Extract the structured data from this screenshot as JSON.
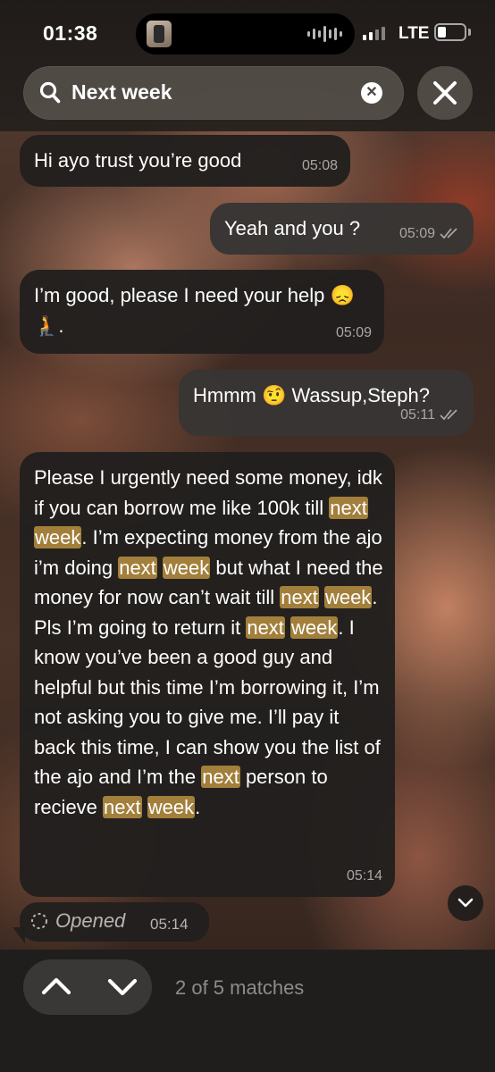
{
  "status_bar": {
    "time": "01:38",
    "network": "LTE"
  },
  "search": {
    "query": "Next week",
    "icon": "search-icon",
    "clear_icon": "clear-icon",
    "close_icon": "close-icon"
  },
  "messages": [
    {
      "direction": "incoming",
      "text": "Hi ayo trust you’re good",
      "time": "05:08",
      "read_receipt": false
    },
    {
      "direction": "outgoing",
      "text": "Yeah and you ?",
      "time": "05:09",
      "read_receipt": true
    },
    {
      "direction": "incoming",
      "text": "I’m good, please I need your help 😞 🧎.",
      "time": "05:09",
      "read_receipt": false
    },
    {
      "direction": "outgoing",
      "text": "Hmmm 🤨 Wassup,Steph?",
      "time": "05:11",
      "read_receipt": true
    },
    {
      "direction": "incoming",
      "text": "Please I urgently need some money, idk if you can borrow me like 100k till next week. I’m expecting money from the ajo i’m doing next week but what I need the money for now can’t wait till next week. Pls I’m going to return it next week. I know you’ve been a good guy and helpful but this time I’m borrowing it, I’m not asking you to give me. I’ll pay it back this time, I can show you the list of the ajo and I’m the next person to recieve next week.",
      "time": "05:14",
      "read_receipt": false
    }
  ],
  "opened_status": {
    "label": "Opened",
    "time": "05:14"
  },
  "search_nav": {
    "match_text": "2 of 5 matches"
  },
  "colors": {
    "highlight": "#a37f3c",
    "bubble_incoming": "#211f1e",
    "bubble_outgoing": "#373534",
    "meta_text": "#a9a7a4"
  }
}
